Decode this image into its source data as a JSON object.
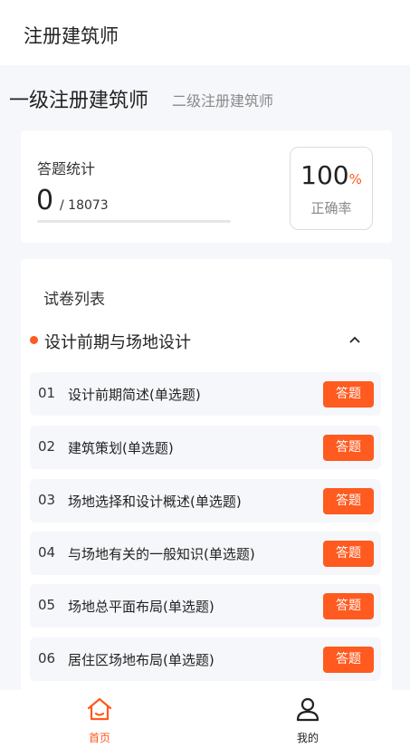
{
  "app": {
    "title": "注册建筑师"
  },
  "level_tabs": {
    "active": "一级注册建筑师",
    "inactive": "二级注册建筑师"
  },
  "stats": {
    "label": "答题统计",
    "answered": "0",
    "total": "/ 18073",
    "progress": 0,
    "accuracy_value": "100",
    "accuracy_unit": "%",
    "accuracy_label": "正确率"
  },
  "paper_list": {
    "title": "试卷列表",
    "section": {
      "name": "设计前期与场地设计",
      "expanded": true
    },
    "items": [
      {
        "num": "01",
        "name": "设计前期简述(单选题)",
        "button": "答题"
      },
      {
        "num": "02",
        "name": "建筑策划(单选题)",
        "button": "答题"
      },
      {
        "num": "03",
        "name": "场地选择和设计概述(单选题)",
        "button": "答题"
      },
      {
        "num": "04",
        "name": "与场地有关的一般知识(单选题)",
        "button": "答题"
      },
      {
        "num": "05",
        "name": "场地总平面布局(单选题)",
        "button": "答题"
      },
      {
        "num": "06",
        "name": "居住区场地布局(单选题)",
        "button": "答题"
      }
    ]
  },
  "bottom_nav": {
    "items": [
      {
        "label": "首页",
        "icon": "home-icon",
        "active": true
      },
      {
        "label": "我的",
        "icon": "user-icon",
        "active": false
      }
    ]
  },
  "colors": {
    "accent": "#ff5a1f",
    "background": "#f6f7fb",
    "card": "#ffffff"
  }
}
